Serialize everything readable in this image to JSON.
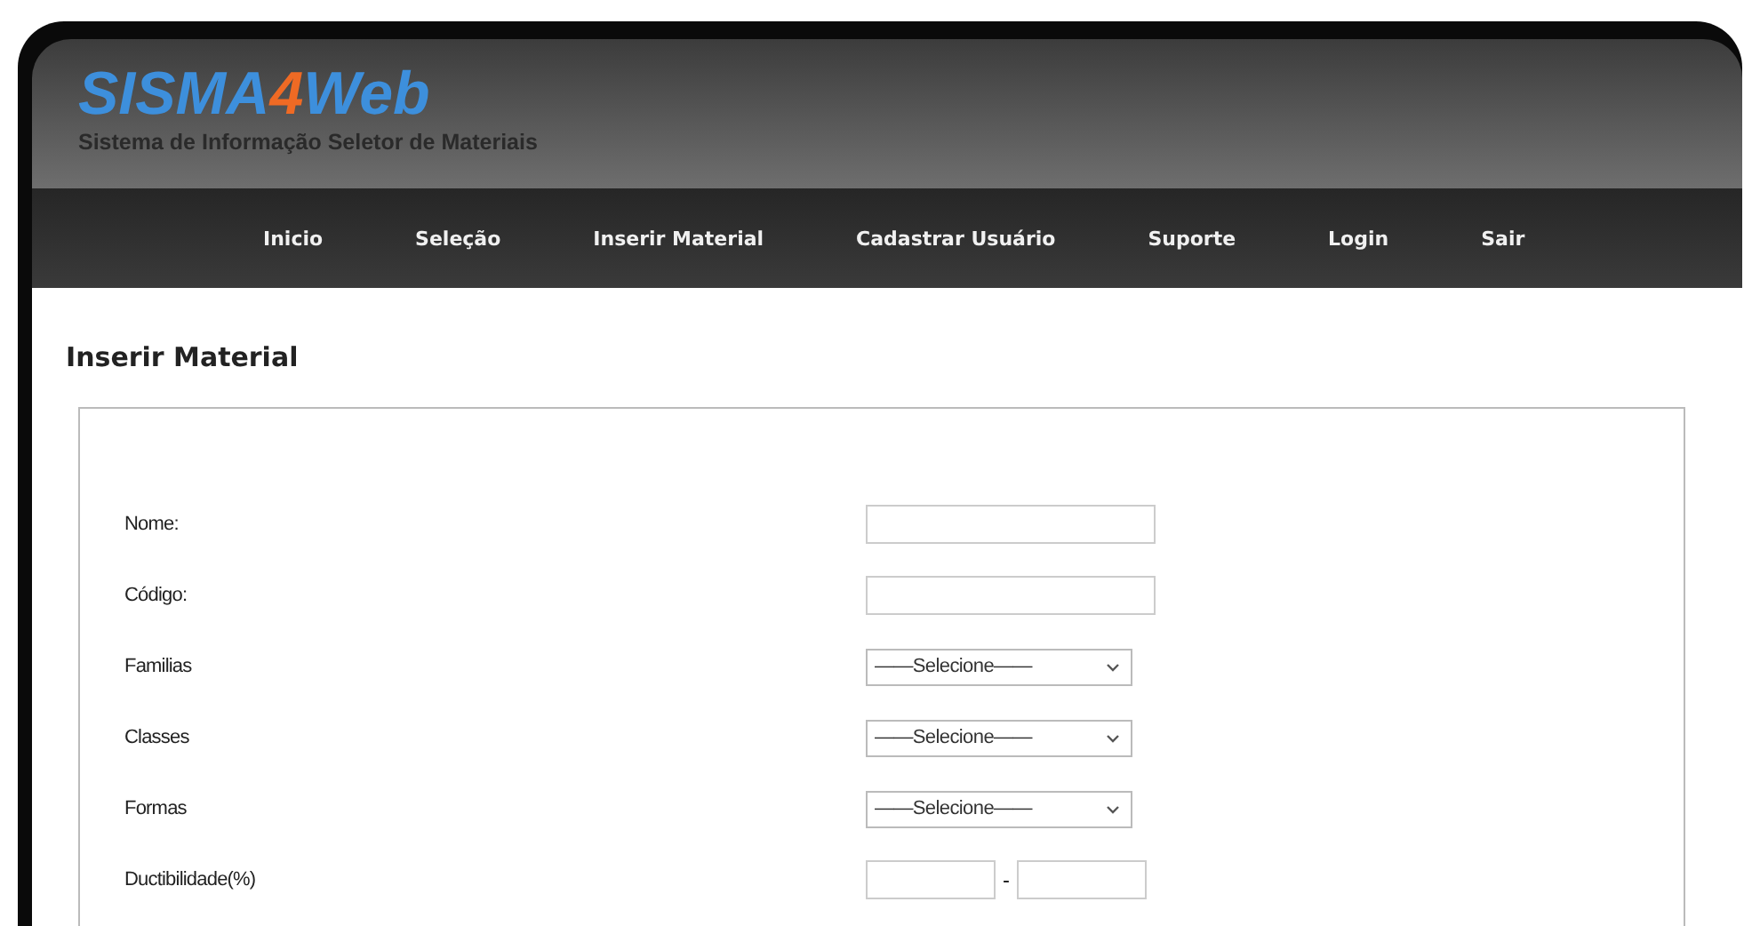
{
  "header": {
    "logo_parts": [
      {
        "text": "SISMA",
        "accent": false
      },
      {
        "text": "4",
        "accent": true
      },
      {
        "text": "Web",
        "accent": false
      }
    ],
    "subtitle": "Sistema de Informação Seletor de Materiais"
  },
  "nav": [
    "Inicio",
    "Seleção",
    "Inserir Material",
    "Cadastrar Usuário",
    "Suporte",
    "Login",
    "Sair"
  ],
  "page_title": "Inserir Material",
  "form": [
    {
      "label": "Nome:",
      "kind": "text"
    },
    {
      "label": "Código:",
      "kind": "text"
    },
    {
      "label": "Familias",
      "kind": "select",
      "value": "——Selecione——"
    },
    {
      "label": "Classes",
      "kind": "select",
      "value": "——Selecione——"
    },
    {
      "label": "Formas",
      "kind": "select",
      "value": "——Selecione——"
    },
    {
      "label": "Ductibilidade(%)",
      "kind": "range",
      "separator": "-"
    }
  ]
}
